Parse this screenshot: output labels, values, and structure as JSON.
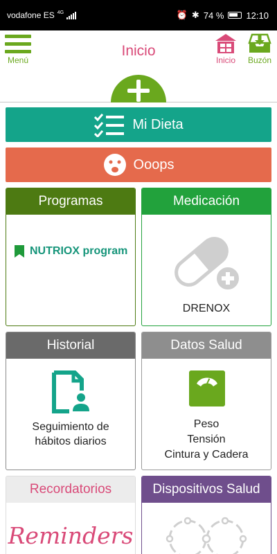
{
  "statusbar": {
    "carrier": "vodafone ES",
    "network": "4G",
    "battery": "74 %",
    "time": "12:10"
  },
  "header": {
    "menu_label": "Menú",
    "title": "Inicio",
    "home_label": "Inicio",
    "mailbox_label": "Buzón"
  },
  "actions": {
    "diet_label": "Mi Dieta",
    "oops_label": "Ooops"
  },
  "cards": {
    "programas": {
      "title": "Programas",
      "item": "NUTRIOX program"
    },
    "medicacion": {
      "title": "Medicación",
      "item": "DRENOX"
    },
    "historial": {
      "title": "Historial",
      "line1": "Seguimiento de",
      "line2": "hábitos diarios"
    },
    "datos_salud": {
      "title": "Datos Salud",
      "line1": "Peso",
      "line2": "Tensión",
      "line3": "Cintura y Cadera"
    },
    "recordatorios": {
      "title": "Recordatorios",
      "logo_text": "Reminders"
    },
    "dispositivos": {
      "title": "Dispositivos Salud"
    }
  },
  "colors": {
    "brand_green": "#6aa81e",
    "brand_pink": "#d94a78",
    "diet_teal": "#14a48a",
    "oops_orange": "#e56a4c"
  }
}
